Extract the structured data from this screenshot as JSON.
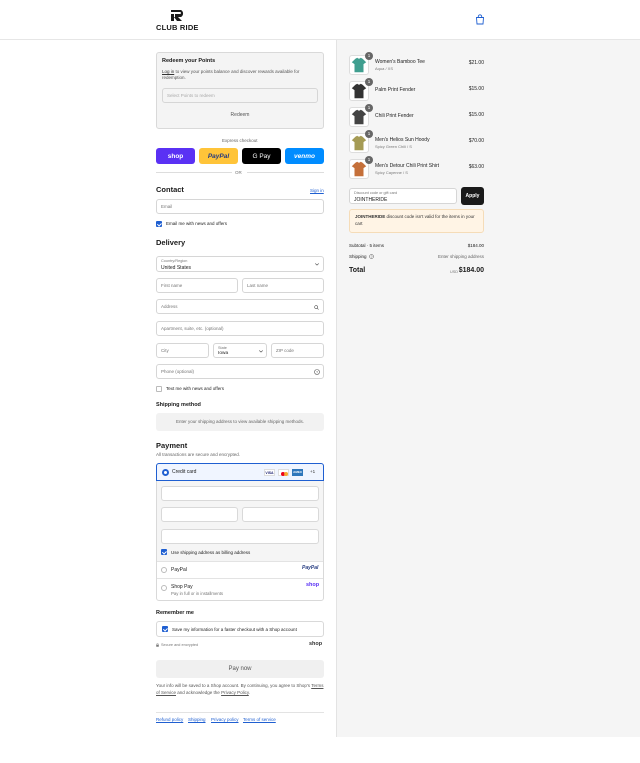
{
  "header": {
    "logo_text": "CLUB RIDE"
  },
  "redeem": {
    "title": "Redeem your Points",
    "login_link": "Log in",
    "desc": "to view your points balance and discover rewards available for redemption.",
    "select_placeholder": "Select Points to redeem",
    "button": "Redeem"
  },
  "express": {
    "label": "Express checkout",
    "shop_pay": "shop",
    "paypal": "PayPal",
    "gpay": "G Pay",
    "venmo": "venmo",
    "or": "OR"
  },
  "contact": {
    "title": "Contact",
    "sign_in": "Sign in",
    "email_placeholder": "Email",
    "news_label": "Email me with news and offers"
  },
  "delivery": {
    "title": "Delivery",
    "country_label": "Country/Region",
    "country_value": "United States",
    "first_name": "First name",
    "last_name": "Last name",
    "address": "Address",
    "apartment": "Apartment, suite, etc. (optional)",
    "city": "City",
    "state_label": "State",
    "state_value": "Iowa",
    "zip": "ZIP code",
    "phone": "Phone (optional)",
    "text_label": "Text me with news and offers"
  },
  "shipping_method": {
    "title": "Shipping method",
    "message": "Enter your shipping address to view available shipping methods."
  },
  "payment": {
    "title": "Payment",
    "subtitle": "All transactions are secure and encrypted.",
    "credit_card": "Credit card",
    "card_badges": {
      "visa": "VISA",
      "amex": "AMEX",
      "more": "+1"
    },
    "billing_label": "Use shipping address as billing address",
    "paypal": "PayPal",
    "paypal_logo": "PayPal",
    "shop_pay": "Shop Pay",
    "shop_pay_sub": "Pay in full or in installments",
    "shop_logo": "shop"
  },
  "remember": {
    "title": "Remember me",
    "save_label": "Save my information for a faster checkout with a Shop account",
    "secure": "Secure and encrypted",
    "shop_logo": "shop"
  },
  "pay_now": "Pay now",
  "legal": {
    "line1": "Your info will be saved to a Shop account. By continuing, you agree to Shop's",
    "terms": "Terms of Service",
    "and": "and acknowledge the",
    "privacy": "Privacy Policy",
    "dot": "."
  },
  "footer_links": [
    "Refund policy",
    "Shipping",
    "Privacy policy",
    "Terms of service"
  ],
  "cart": {
    "items": [
      {
        "qty": "1",
        "name": "Women's Bamboo Tee",
        "variant": "Aqua / XS",
        "price": "$21.00",
        "color": "#3f9e8f"
      },
      {
        "qty": "1",
        "name": "Palm Print Fender",
        "variant": "",
        "price": "$15.00",
        "color": "#333333"
      },
      {
        "qty": "1",
        "name": "Chili Print Fender",
        "variant": "",
        "price": "$15.00",
        "color": "#444444"
      },
      {
        "qty": "1",
        "name": "Men's Helios Sun Hoody",
        "variant": "Spicy Green Chili / S",
        "price": "$70.00",
        "color": "#a59b55"
      },
      {
        "qty": "1",
        "name": "Men's Detour Chili Print Shirt",
        "variant": "Spicy Cayenne / S",
        "price": "$63.00",
        "color": "#c5703a"
      }
    ],
    "discount_label": "Discount code or gift card",
    "discount_value": "JOINTHERIDE",
    "apply": "Apply",
    "warning_code": "JOINTHERIDE",
    "warning_text": "discount code isn't valid for the items in your cart",
    "subtotal_label": "Subtotal · 5 items",
    "subtotal_value": "$184.00",
    "shipping_label": "Shipping",
    "shipping_value": "Enter shipping address",
    "total_label": "Total",
    "currency": "USD",
    "total_value": "$184.00"
  }
}
